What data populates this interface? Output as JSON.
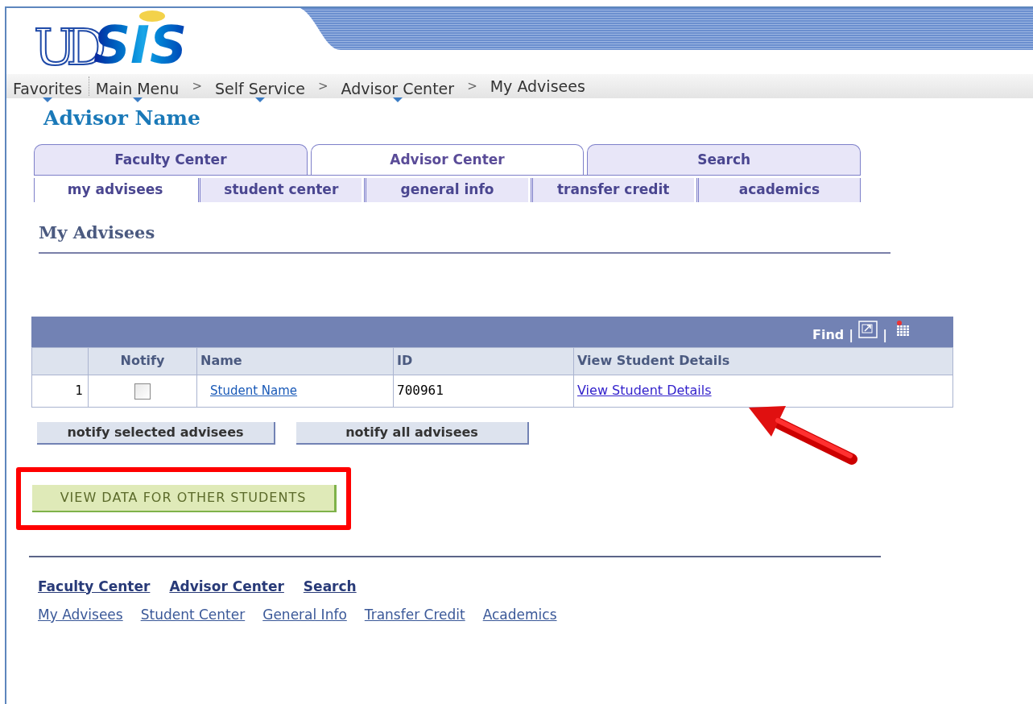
{
  "logo": {
    "mark": "UD",
    "text": "SIS"
  },
  "breadcrumb": [
    {
      "label": "Favorites",
      "menu": true
    },
    {
      "label": "Main Menu",
      "menu": true
    },
    {
      "label": "Self Service",
      "menu": true
    },
    {
      "label": "Advisor Center",
      "menu": true
    },
    {
      "label": "My Advisees",
      "menu": false
    }
  ],
  "separator": ">",
  "advisor_name": "Advisor Name",
  "tabs": [
    {
      "label": "Faculty Center",
      "selected": false
    },
    {
      "label": "Advisor Center",
      "selected": true
    },
    {
      "label": "Search",
      "selected": false
    }
  ],
  "subtabs": [
    {
      "label": "my advisees",
      "selected": true
    },
    {
      "label": "student center",
      "selected": false
    },
    {
      "label": "general info",
      "selected": false
    },
    {
      "label": "transfer credit",
      "selected": false
    },
    {
      "label": "academics",
      "selected": false
    }
  ],
  "page_title": "My Advisees",
  "grid": {
    "find": "Find",
    "divider": "|",
    "columns": [
      "Notify",
      "Name",
      "ID",
      "View Student Details"
    ],
    "rows": [
      {
        "number": "1",
        "checked": false,
        "name": "Student Name",
        "id": "700961",
        "details": "View Student Details"
      }
    ]
  },
  "buttons": [
    "notify selected advisees",
    "notify all advisees"
  ],
  "other_students_button": "VIEW DATA FOR OTHER STUDENTS",
  "footer_links": [
    "Faculty Center",
    "Advisor Center",
    "Search"
  ],
  "footer_sublinks": [
    "My Advisees",
    "Student Center",
    "General Info",
    "Transfer Credit",
    "Academics"
  ]
}
